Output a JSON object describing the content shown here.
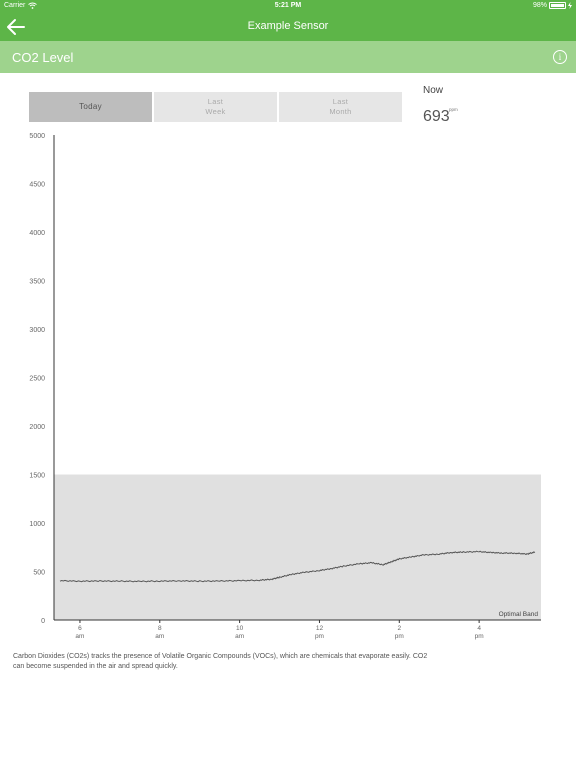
{
  "status_bar": {
    "carrier": "Carrier",
    "time": "5:21 PM",
    "battery_text": "98%",
    "battery_level": 0.98,
    "icons": [
      "wifi-icon",
      "battery-icon",
      "charging-icon"
    ]
  },
  "nav": {
    "title": "Example Sensor",
    "back_icon": "arrow-left-icon"
  },
  "section": {
    "title": "CO2 Level",
    "info_icon": "info-icon",
    "info_glyph": "i"
  },
  "segments": [
    {
      "line1": "Today",
      "line2": "",
      "selected": true
    },
    {
      "line1": "Last",
      "line2": "Week",
      "selected": false
    },
    {
      "line1": "Last",
      "line2": "Month",
      "selected": false
    }
  ],
  "now": {
    "label": "Now",
    "value": "693",
    "unit": "ppm"
  },
  "chart_data": {
    "type": "line",
    "y_ticks": [
      "5000",
      "4500",
      "4000",
      "3500",
      "3000",
      "2500",
      "2000",
      "1500",
      "1000",
      "500",
      "0"
    ],
    "ylim": [
      0,
      5000
    ],
    "x_ticks": [
      {
        "value": 6,
        "line1": "6",
        "line2": "am"
      },
      {
        "value": 8,
        "line1": "8",
        "line2": "am"
      },
      {
        "value": 10,
        "line1": "10",
        "line2": "am"
      },
      {
        "value": 12,
        "line1": "12",
        "line2": "pm"
      },
      {
        "value": 14,
        "line1": "2",
        "line2": "pm"
      },
      {
        "value": 16,
        "line1": "4",
        "line2": "pm"
      }
    ],
    "xlim": [
      5.35,
      17.55
    ],
    "band": {
      "label": "Optimal Band",
      "from": 0,
      "to": 1500,
      "color": "#e0e0e0"
    },
    "series": [
      {
        "color": "#555555",
        "x": [
          5.5,
          6.0,
          6.5,
          7.0,
          7.5,
          8.0,
          8.5,
          9.0,
          9.5,
          10.0,
          10.5,
          10.8,
          11.0,
          11.3,
          11.6,
          12.0,
          12.3,
          12.6,
          13.0,
          13.3,
          13.6,
          13.8,
          14.0,
          14.3,
          14.6,
          15.0,
          15.3,
          15.6,
          16.0,
          16.3,
          16.6,
          16.9,
          17.2,
          17.4
        ],
        "values": [
          405,
          400,
          402,
          400,
          398,
          401,
          403,
          400,
          402,
          405,
          410,
          420,
          440,
          470,
          490,
          510,
          530,
          555,
          580,
          590,
          570,
          600,
          630,
          650,
          670,
          680,
          695,
          700,
          705,
          695,
          690,
          688,
          680,
          700
        ]
      }
    ],
    "grid": false,
    "legend": "none"
  },
  "description": "Carbon Dioxides (CO2s) tracks the presence of Volatile Organic Compounds (VOCs), which are chemicals that evaporate easily. CO2 can become suspended in the air and spread quickly."
}
